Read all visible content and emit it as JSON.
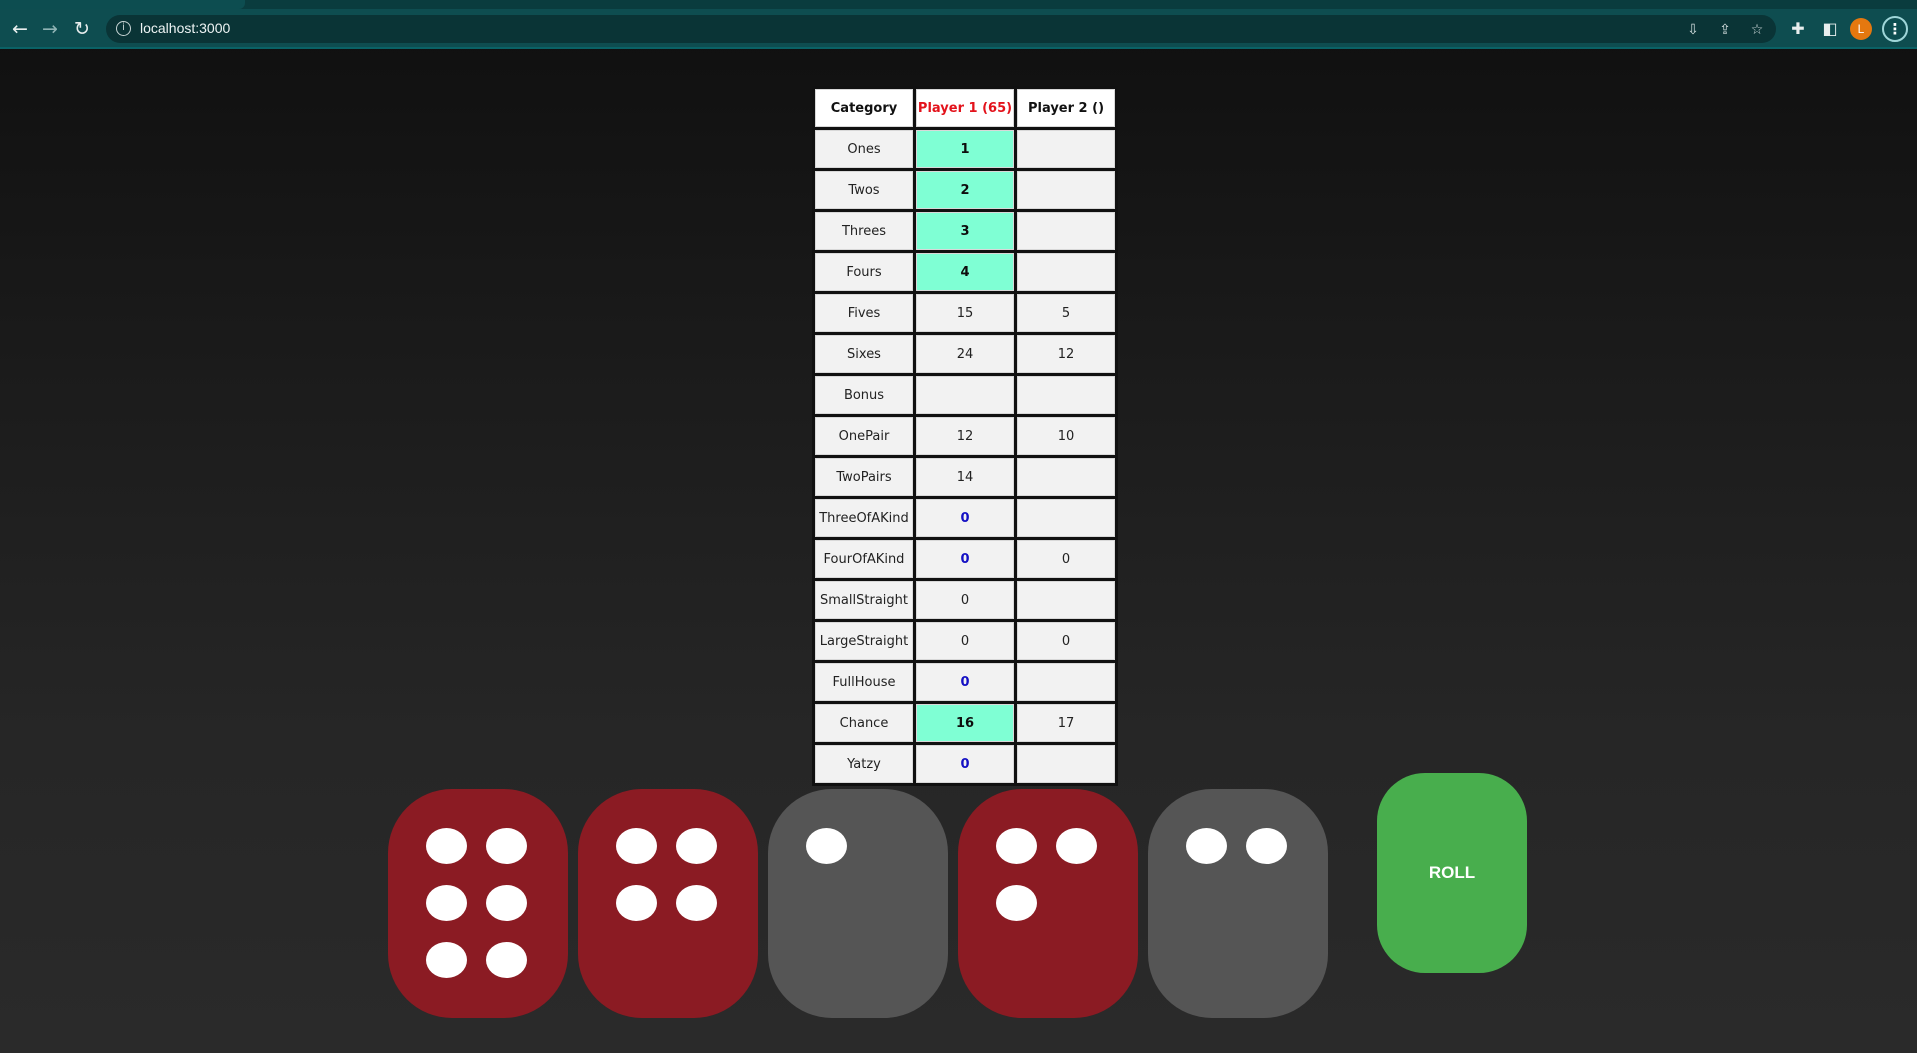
{
  "browser": {
    "url": "localhost:3000",
    "avatar_letter": "L",
    "icons": [
      "back-icon",
      "forward-icon",
      "reload-icon",
      "info-icon",
      "install-icon",
      "share-icon",
      "star-icon",
      "extensions-icon",
      "sidepanel-icon",
      "menu-icon"
    ]
  },
  "scoreboard": {
    "headers": [
      "Category",
      "Player 1 (65)",
      "Player 2 ()"
    ],
    "active_player_color": "#e3121b",
    "rows": [
      {
        "category": "Ones",
        "p1": "1",
        "p2": "",
        "p1_style": "locked"
      },
      {
        "category": "Twos",
        "p1": "2",
        "p2": "",
        "p1_style": "locked"
      },
      {
        "category": "Threes",
        "p1": "3",
        "p2": "",
        "p1_style": "locked"
      },
      {
        "category": "Fours",
        "p1": "4",
        "p2": "",
        "p1_style": "locked"
      },
      {
        "category": "Fives",
        "p1": "15",
        "p2": "5",
        "p1_style": ""
      },
      {
        "category": "Sixes",
        "p1": "24",
        "p2": "12",
        "p1_style": ""
      },
      {
        "category": "Bonus",
        "p1": "",
        "p2": "",
        "p1_style": ""
      },
      {
        "category": "OnePair",
        "p1": "12",
        "p2": "10",
        "p1_style": ""
      },
      {
        "category": "TwoPairs",
        "p1": "14",
        "p2": "",
        "p1_style": ""
      },
      {
        "category": "ThreeOfAKind",
        "p1": "0",
        "p2": "",
        "p1_style": "zero-pick"
      },
      {
        "category": "FourOfAKind",
        "p1": "0",
        "p2": "0",
        "p1_style": "zero-pick"
      },
      {
        "category": "SmallStraight",
        "p1": "0",
        "p2": "",
        "p1_style": ""
      },
      {
        "category": "LargeStraight",
        "p1": "0",
        "p2": "0",
        "p1_style": ""
      },
      {
        "category": "FullHouse",
        "p1": "0",
        "p2": "",
        "p1_style": "zero-pick"
      },
      {
        "category": "Chance",
        "p1": "16",
        "p2": "17",
        "p1_style": "locked"
      },
      {
        "category": "Yatzy",
        "p1": "0",
        "p2": "",
        "p1_style": "zero-pick"
      }
    ]
  },
  "dice": [
    {
      "value": 6,
      "held": true
    },
    {
      "value": 4,
      "held": true
    },
    {
      "value": 1,
      "held": false
    },
    {
      "value": 3,
      "held": true
    },
    {
      "value": 2,
      "held": false
    }
  ],
  "colors": {
    "held_die": "#8b1b23",
    "free_die": "#555555",
    "locked_cell": "#7fffd4",
    "roll_button": "#48ae4d"
  },
  "roll_label": "ROLL"
}
